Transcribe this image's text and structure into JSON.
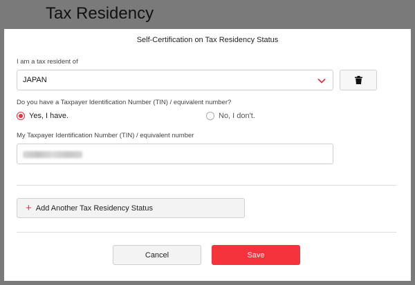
{
  "page": {
    "title": "Tax Residency"
  },
  "modal": {
    "title": "Self-Certification on Tax Residency Status",
    "resident_label": "I am a tax resident of",
    "country_value": "JAPAN",
    "tin_question": "Do you have a Taxpayer Identification Number (TIN) / equivalent number?",
    "radio_yes": "Yes, I have.",
    "radio_no": "No, I don't.",
    "radio_selected": "yes",
    "tin_label": "My Taxpayer Identification Number (TIN) / equivalent number",
    "add_button": "Add Another Tax Residency Status",
    "cancel_button": "Cancel",
    "save_button": "Save"
  },
  "colors": {
    "accent": "#f4333c",
    "overlay": "#7a7a7a"
  },
  "icons": {
    "select_arrow": "chevron-down-icon",
    "delete": "trash-icon",
    "add": "plus-icon"
  }
}
